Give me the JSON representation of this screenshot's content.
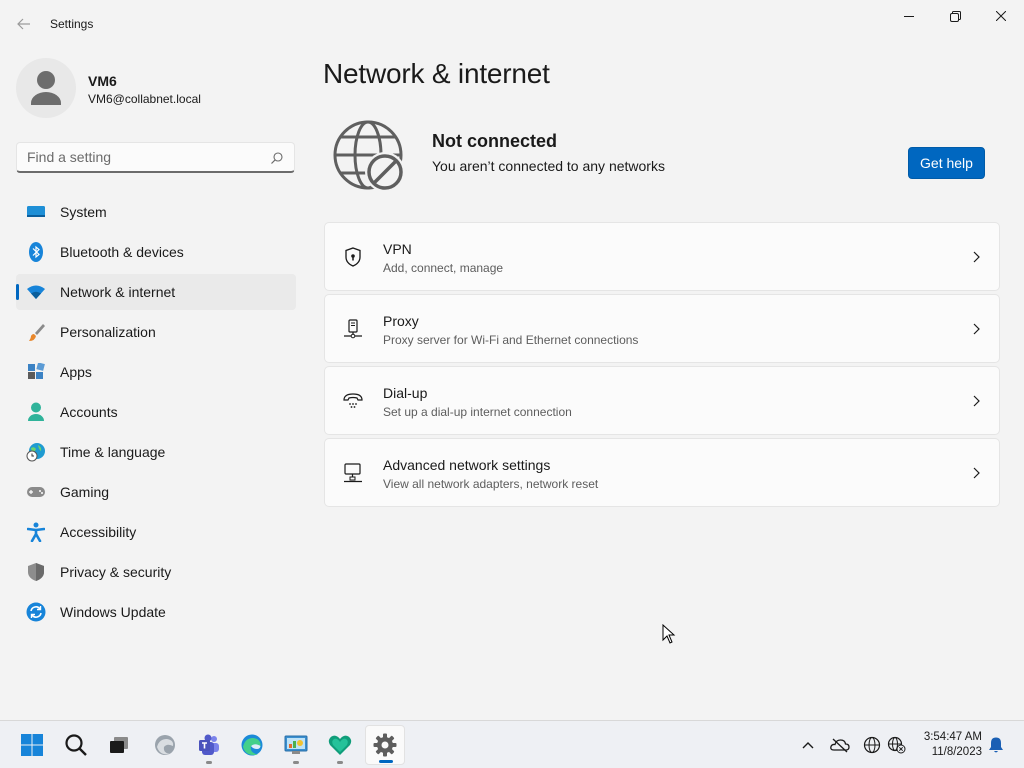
{
  "window": {
    "title": "Settings"
  },
  "profile": {
    "name": "VM6",
    "email": "VM6@collabnet.local"
  },
  "search": {
    "placeholder": "Find a setting"
  },
  "sidebar": {
    "items": [
      {
        "label": "System",
        "icon": "system-icon"
      },
      {
        "label": "Bluetooth & devices",
        "icon": "bluetooth-icon"
      },
      {
        "label": "Network & internet",
        "icon": "wifi-icon",
        "selected": true
      },
      {
        "label": "Personalization",
        "icon": "brush-icon"
      },
      {
        "label": "Apps",
        "icon": "apps-icon"
      },
      {
        "label": "Accounts",
        "icon": "accounts-icon"
      },
      {
        "label": "Time & language",
        "icon": "globe-clock-icon"
      },
      {
        "label": "Gaming",
        "icon": "gamepad-icon"
      },
      {
        "label": "Accessibility",
        "icon": "accessibility-icon"
      },
      {
        "label": "Privacy & security",
        "icon": "shield-icon"
      },
      {
        "label": "Windows Update",
        "icon": "update-icon"
      }
    ]
  },
  "main": {
    "title": "Network & internet",
    "status": {
      "title": "Not connected",
      "subtitle": "You aren’t connected to any networks",
      "help_label": "Get help"
    },
    "cards": [
      {
        "title": "VPN",
        "description": "Add, connect, manage",
        "icon": "vpn-shield-icon"
      },
      {
        "title": "Proxy",
        "description": "Proxy server for Wi-Fi and Ethernet connections",
        "icon": "proxy-icon"
      },
      {
        "title": "Dial-up",
        "description": "Set up a dial-up internet connection",
        "icon": "dialup-icon"
      },
      {
        "title": "Advanced network settings",
        "description": "View all network adapters, network reset",
        "icon": "network-adapter-icon"
      }
    ]
  },
  "taskbar": {
    "time": "3:54:47 AM",
    "date": "11/8/2023",
    "apps": [
      "start",
      "search",
      "task-view",
      "edge-beta",
      "teams",
      "edge",
      "control-panel",
      "defender",
      "settings"
    ]
  },
  "colors": {
    "accent": "#0067c0",
    "background": "#f3f3f3",
    "card": "#fbfbfb"
  }
}
